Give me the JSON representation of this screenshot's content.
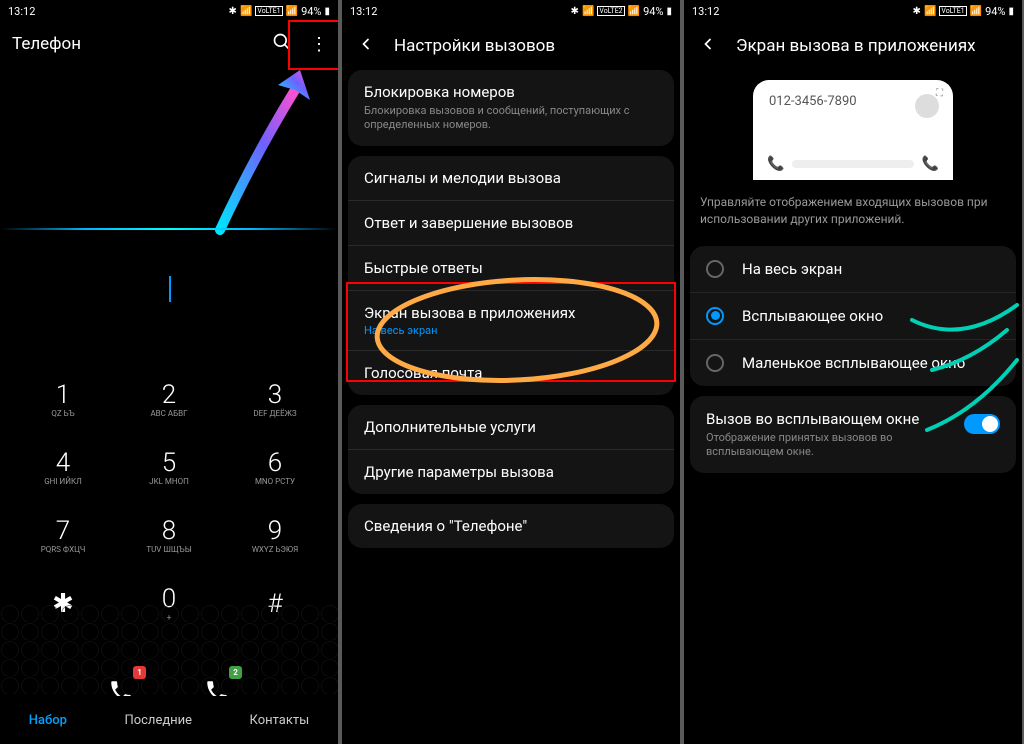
{
  "status": {
    "time": "13:12",
    "battery": "94%",
    "net1": "VoLTE1",
    "net2": "VoLTE2"
  },
  "phone1": {
    "title": "Телефон",
    "keys": [
      {
        "n": "1",
        "l": "QZ\nЬЪ"
      },
      {
        "n": "2",
        "l": "ABC\nАБВГ"
      },
      {
        "n": "3",
        "l": "DEF\nДЕЁЖЗ"
      },
      {
        "n": "4",
        "l": "GHI\nИЙКЛ"
      },
      {
        "n": "5",
        "l": "JKL\nМНОП"
      },
      {
        "n": "6",
        "l": "MNO\nРСТУ"
      },
      {
        "n": "7",
        "l": "PQRS\nФХЦЧ"
      },
      {
        "n": "8",
        "l": "TUV\nШЩЪЫ"
      },
      {
        "n": "9",
        "l": "WXYZ\nЬЭЮЯ"
      },
      {
        "n": "✱",
        "l": ""
      },
      {
        "n": "0",
        "l": "+"
      },
      {
        "n": "#",
        "l": ""
      }
    ],
    "sim1": "1",
    "sim2": "2",
    "tabs": [
      "Набор",
      "Последние",
      "Контакты"
    ]
  },
  "phone2": {
    "title": "Настройки вызовов",
    "block": {
      "title": "Блокировка номеров",
      "desc": "Блокировка вызовов и сообщений, поступающих с определенных номеров."
    },
    "group1": [
      {
        "title": "Сигналы и мелодии вызова"
      },
      {
        "title": "Ответ и завершение вызовов"
      },
      {
        "title": "Быстрые ответы"
      },
      {
        "title": "Экран вызова в приложениях",
        "sub": "На весь экран"
      },
      {
        "title": "Голосовая почта"
      }
    ],
    "group2": [
      {
        "title": "Дополнительные услуги"
      },
      {
        "title": "Другие параметры вызова"
      }
    ],
    "about": {
      "title": "Сведения о \"Телефоне\""
    }
  },
  "phone3": {
    "title": "Экран вызова в приложениях",
    "preview_number": "012-3456-7890",
    "helper": "Управляйте отображением входящих вызовов при использовании других приложений.",
    "options": [
      {
        "label": "На весь экран",
        "checked": false
      },
      {
        "label": "Всплывающее окно",
        "checked": true
      },
      {
        "label": "Маленькое всплывающее окно",
        "checked": false
      }
    ],
    "popup": {
      "title": "Вызов во всплывающем окне",
      "desc": "Отображение принятых вызовов во всплывающем окне."
    }
  }
}
